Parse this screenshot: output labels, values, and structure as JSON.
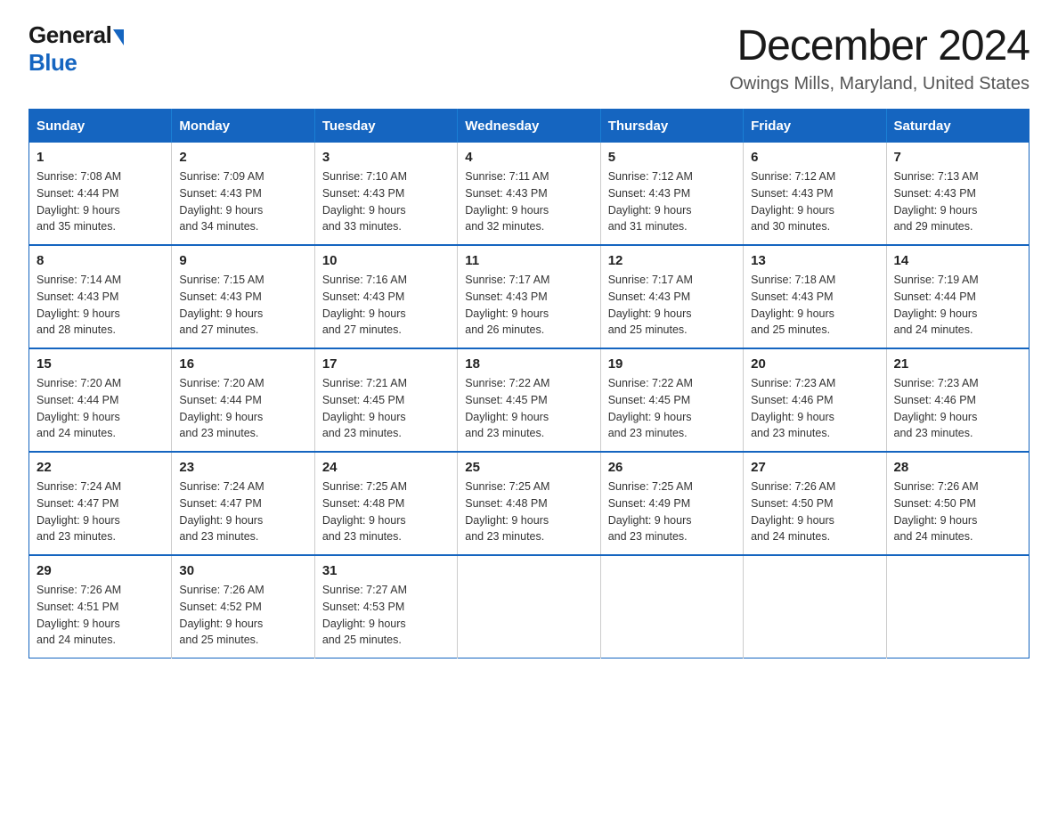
{
  "header": {
    "logo_general": "General",
    "logo_blue": "Blue",
    "title": "December 2024",
    "subtitle": "Owings Mills, Maryland, United States"
  },
  "days_of_week": [
    "Sunday",
    "Monday",
    "Tuesday",
    "Wednesday",
    "Thursday",
    "Friday",
    "Saturday"
  ],
  "weeks": [
    [
      {
        "day": "1",
        "sunrise": "7:08 AM",
        "sunset": "4:44 PM",
        "daylight": "9 hours and 35 minutes."
      },
      {
        "day": "2",
        "sunrise": "7:09 AM",
        "sunset": "4:43 PM",
        "daylight": "9 hours and 34 minutes."
      },
      {
        "day": "3",
        "sunrise": "7:10 AM",
        "sunset": "4:43 PM",
        "daylight": "9 hours and 33 minutes."
      },
      {
        "day": "4",
        "sunrise": "7:11 AM",
        "sunset": "4:43 PM",
        "daylight": "9 hours and 32 minutes."
      },
      {
        "day": "5",
        "sunrise": "7:12 AM",
        "sunset": "4:43 PM",
        "daylight": "9 hours and 31 minutes."
      },
      {
        "day": "6",
        "sunrise": "7:12 AM",
        "sunset": "4:43 PM",
        "daylight": "9 hours and 30 minutes."
      },
      {
        "day": "7",
        "sunrise": "7:13 AM",
        "sunset": "4:43 PM",
        "daylight": "9 hours and 29 minutes."
      }
    ],
    [
      {
        "day": "8",
        "sunrise": "7:14 AM",
        "sunset": "4:43 PM",
        "daylight": "9 hours and 28 minutes."
      },
      {
        "day": "9",
        "sunrise": "7:15 AM",
        "sunset": "4:43 PM",
        "daylight": "9 hours and 27 minutes."
      },
      {
        "day": "10",
        "sunrise": "7:16 AM",
        "sunset": "4:43 PM",
        "daylight": "9 hours and 27 minutes."
      },
      {
        "day": "11",
        "sunrise": "7:17 AM",
        "sunset": "4:43 PM",
        "daylight": "9 hours and 26 minutes."
      },
      {
        "day": "12",
        "sunrise": "7:17 AM",
        "sunset": "4:43 PM",
        "daylight": "9 hours and 25 minutes."
      },
      {
        "day": "13",
        "sunrise": "7:18 AM",
        "sunset": "4:43 PM",
        "daylight": "9 hours and 25 minutes."
      },
      {
        "day": "14",
        "sunrise": "7:19 AM",
        "sunset": "4:44 PM",
        "daylight": "9 hours and 24 minutes."
      }
    ],
    [
      {
        "day": "15",
        "sunrise": "7:20 AM",
        "sunset": "4:44 PM",
        "daylight": "9 hours and 24 minutes."
      },
      {
        "day": "16",
        "sunrise": "7:20 AM",
        "sunset": "4:44 PM",
        "daylight": "9 hours and 23 minutes."
      },
      {
        "day": "17",
        "sunrise": "7:21 AM",
        "sunset": "4:45 PM",
        "daylight": "9 hours and 23 minutes."
      },
      {
        "day": "18",
        "sunrise": "7:22 AM",
        "sunset": "4:45 PM",
        "daylight": "9 hours and 23 minutes."
      },
      {
        "day": "19",
        "sunrise": "7:22 AM",
        "sunset": "4:45 PM",
        "daylight": "9 hours and 23 minutes."
      },
      {
        "day": "20",
        "sunrise": "7:23 AM",
        "sunset": "4:46 PM",
        "daylight": "9 hours and 23 minutes."
      },
      {
        "day": "21",
        "sunrise": "7:23 AM",
        "sunset": "4:46 PM",
        "daylight": "9 hours and 23 minutes."
      }
    ],
    [
      {
        "day": "22",
        "sunrise": "7:24 AM",
        "sunset": "4:47 PM",
        "daylight": "9 hours and 23 minutes."
      },
      {
        "day": "23",
        "sunrise": "7:24 AM",
        "sunset": "4:47 PM",
        "daylight": "9 hours and 23 minutes."
      },
      {
        "day": "24",
        "sunrise": "7:25 AM",
        "sunset": "4:48 PM",
        "daylight": "9 hours and 23 minutes."
      },
      {
        "day": "25",
        "sunrise": "7:25 AM",
        "sunset": "4:48 PM",
        "daylight": "9 hours and 23 minutes."
      },
      {
        "day": "26",
        "sunrise": "7:25 AM",
        "sunset": "4:49 PM",
        "daylight": "9 hours and 23 minutes."
      },
      {
        "day": "27",
        "sunrise": "7:26 AM",
        "sunset": "4:50 PM",
        "daylight": "9 hours and 24 minutes."
      },
      {
        "day": "28",
        "sunrise": "7:26 AM",
        "sunset": "4:50 PM",
        "daylight": "9 hours and 24 minutes."
      }
    ],
    [
      {
        "day": "29",
        "sunrise": "7:26 AM",
        "sunset": "4:51 PM",
        "daylight": "9 hours and 24 minutes."
      },
      {
        "day": "30",
        "sunrise": "7:26 AM",
        "sunset": "4:52 PM",
        "daylight": "9 hours and 25 minutes."
      },
      {
        "day": "31",
        "sunrise": "7:27 AM",
        "sunset": "4:53 PM",
        "daylight": "9 hours and 25 minutes."
      },
      null,
      null,
      null,
      null
    ]
  ],
  "labels": {
    "sunrise": "Sunrise:",
    "sunset": "Sunset:",
    "daylight": "Daylight:"
  }
}
